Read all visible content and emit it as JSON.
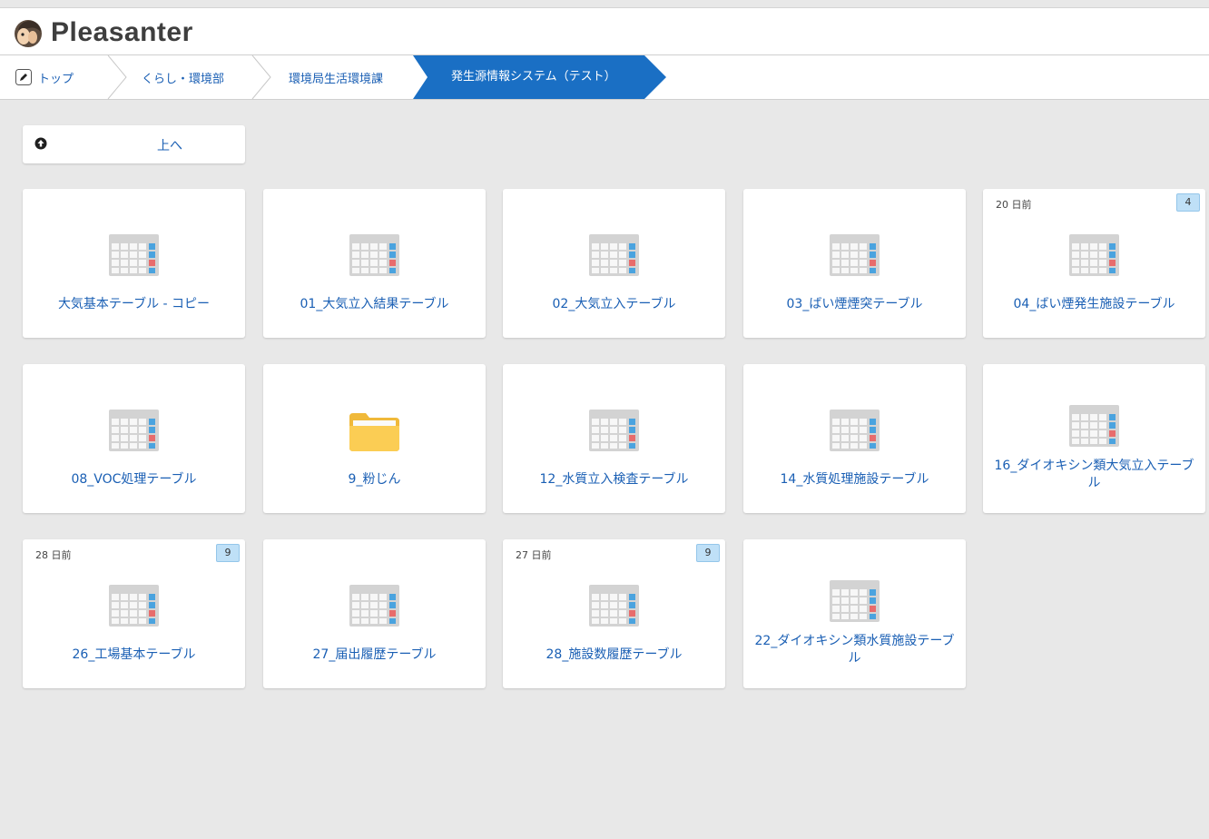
{
  "app": {
    "name": "Pleasanter"
  },
  "breadcrumb": {
    "items": [
      "トップ",
      "くらし・環境部",
      "環境局生活環境課"
    ],
    "current": "発生源情報システム（テスト）"
  },
  "up_button": {
    "label": "上へ"
  },
  "tiles": [
    {
      "label": "大気基本テーブル - コピー",
      "icon": "table-icon",
      "date": "",
      "badge": ""
    },
    {
      "label": "01_大気立入結果テーブル",
      "icon": "table-icon",
      "date": "",
      "badge": ""
    },
    {
      "label": "02_大気立入テーブル",
      "icon": "table-icon",
      "date": "",
      "badge": ""
    },
    {
      "label": "03_ばい煙煙突テーブル",
      "icon": "table-icon",
      "date": "",
      "badge": ""
    },
    {
      "label": "04_ばい煙発生施設テーブル",
      "icon": "table-icon",
      "date": "20 日前",
      "badge": "4"
    },
    {
      "label": "08_VOC処理テーブル",
      "icon": "table-icon",
      "date": "",
      "badge": ""
    },
    {
      "label": "9_粉じん",
      "icon": "folder-icon",
      "date": "",
      "badge": ""
    },
    {
      "label": "12_水質立入検査テーブル",
      "icon": "table-icon",
      "date": "",
      "badge": ""
    },
    {
      "label": "14_水質処理施設テーブル",
      "icon": "table-icon",
      "date": "",
      "badge": ""
    },
    {
      "label": "16_ダイオキシン類大気立入テーブル",
      "icon": "table-icon",
      "date": "",
      "badge": ""
    },
    {
      "label": "26_工場基本テーブル",
      "icon": "table-icon",
      "date": "28 日前",
      "badge": "9"
    },
    {
      "label": "27_届出履歴テーブル",
      "icon": "table-icon",
      "date": "",
      "badge": ""
    },
    {
      "label": "28_施設数履歴テーブル",
      "icon": "table-icon",
      "date": "27 日前",
      "badge": "9"
    },
    {
      "label": "22_ダイオキシン類水質施設テーブル",
      "icon": "table-icon",
      "date": "",
      "badge": ""
    }
  ],
  "colors": {
    "accent": "#1a6fc4",
    "link": "#1a5fb4",
    "background": "#e8e8e8",
    "badge": "#bfe0f7"
  }
}
